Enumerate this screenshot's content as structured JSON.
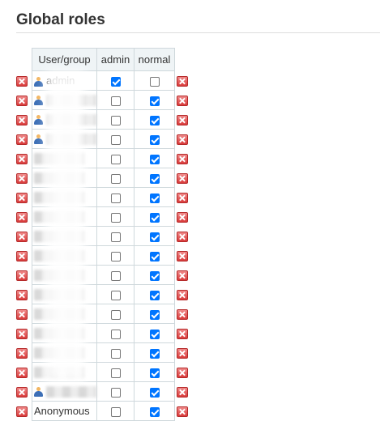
{
  "page": {
    "title": "Global roles"
  },
  "table": {
    "headers": {
      "user_group": "User/group",
      "admin": "admin",
      "normal": "normal"
    },
    "rows": [
      {
        "name": "admin",
        "icon": "user-icon",
        "admin": true,
        "normal": false
      },
      {
        "name": "",
        "icon": "user-icon",
        "admin": false,
        "normal": true
      },
      {
        "name": "",
        "icon": "user-icon",
        "admin": false,
        "normal": true
      },
      {
        "name": "",
        "icon": "user-icon",
        "admin": false,
        "normal": true
      },
      {
        "name": "",
        "icon": "",
        "admin": false,
        "normal": true
      },
      {
        "name": "",
        "icon": "",
        "admin": false,
        "normal": true
      },
      {
        "name": "",
        "icon": "",
        "admin": false,
        "normal": true
      },
      {
        "name": "",
        "icon": "",
        "admin": false,
        "normal": true
      },
      {
        "name": "",
        "icon": "",
        "admin": false,
        "normal": true
      },
      {
        "name": "",
        "icon": "",
        "admin": false,
        "normal": true
      },
      {
        "name": "",
        "icon": "",
        "admin": false,
        "normal": true
      },
      {
        "name": "",
        "icon": "",
        "admin": false,
        "normal": true
      },
      {
        "name": "",
        "icon": "",
        "admin": false,
        "normal": true
      },
      {
        "name": "",
        "icon": "",
        "admin": false,
        "normal": true
      },
      {
        "name": "",
        "icon": "",
        "admin": false,
        "normal": true
      },
      {
        "name": "",
        "icon": "",
        "admin": false,
        "normal": true
      },
      {
        "name": "",
        "icon": "user-icon",
        "admin": false,
        "normal": true
      },
      {
        "name": "Anonymous",
        "icon": "",
        "admin": false,
        "normal": true
      }
    ]
  },
  "colors": {
    "checkbox_checked": "#0075ff",
    "delete_icon": "#d93a3a",
    "header_bg": "#eff4f6",
    "border": "#cfd8dc"
  }
}
